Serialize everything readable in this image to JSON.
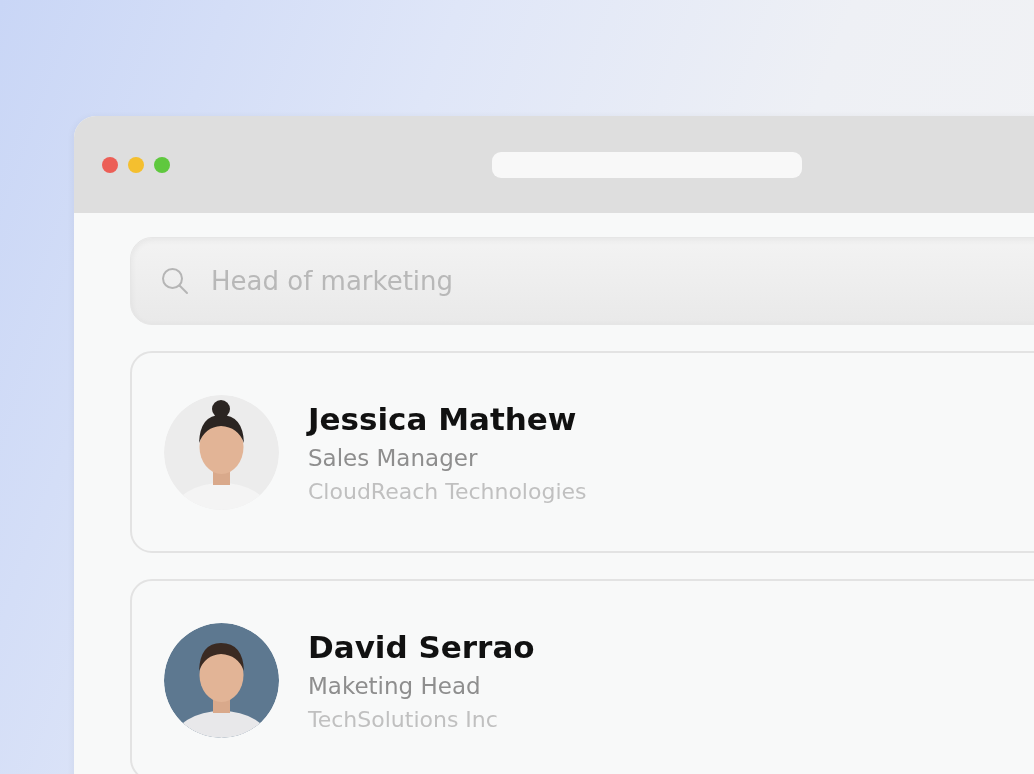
{
  "search": {
    "placeholder": "Head of marketing"
  },
  "contacts": [
    {
      "name": "Jessica Mathew",
      "title": "Sales Manager",
      "company": "CloudReach Technologies"
    },
    {
      "name": "David Serrao",
      "title": "Maketing Head",
      "company": "TechSolutions Inc"
    }
  ]
}
